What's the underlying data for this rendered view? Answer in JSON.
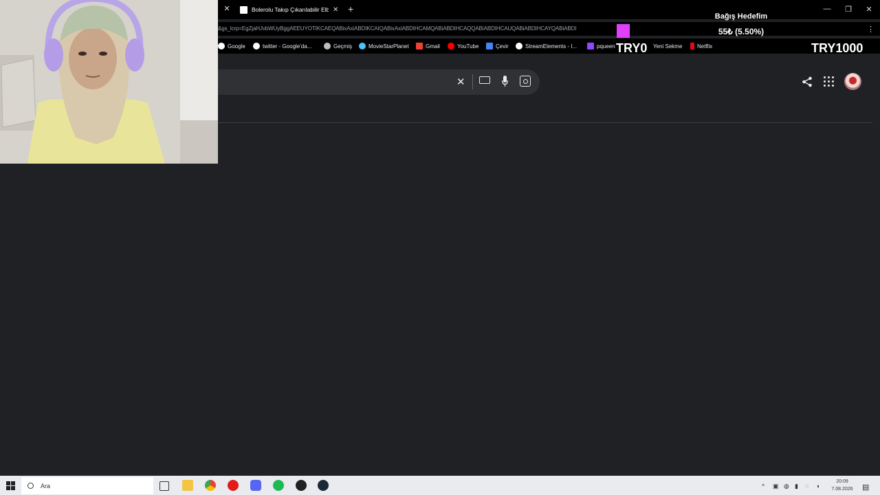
{
  "browser": {
    "active_tab_title": "Bolerolu Takıp Çıkarılabilir Elbise",
    "url": "&gs_lcrp=EgZjaHJvbWUyBggAEEUYOTIKCAEQABixAxiABDIKCAIQABixAxiABDIHCAMQABiABDIHCAQQABiABDIHCAUQABiABDIHCAYQABiABDI",
    "bookmarks": [
      {
        "label": "Google",
        "icon": "google-icon",
        "color": "#ffffff"
      },
      {
        "label": "twitter - Google'da...",
        "icon": "google-icon",
        "color": "#ffffff"
      },
      {
        "label": "Geçmiş",
        "icon": "history-icon",
        "color": "#bdbdbd"
      },
      {
        "label": "MovieStarPlanet",
        "icon": "msp-icon",
        "color": "#4fc3f7"
      },
      {
        "label": "Gmail",
        "icon": "gmail-icon",
        "color": "#ea4335"
      },
      {
        "label": "YouTube",
        "icon": "youtube-icon",
        "color": "#ff0000"
      },
      {
        "label": "Çevir",
        "icon": "translate-icon",
        "color": "#4285f4"
      },
      {
        "label": "StreamElements - I...",
        "icon": "streamelements-icon",
        "color": "#ffffff"
      },
      {
        "label": "pqueen",
        "icon": "twitch-icon",
        "color": "#9146ff"
      },
      {
        "label": "Yeni Sekme",
        "icon": "",
        "color": ""
      },
      {
        "label": "Netflix",
        "icon": "netflix-icon",
        "color": "#e50914"
      }
    ]
  },
  "overlay": {
    "donation_title": "Bağış Hedefim",
    "donation_amount": "55₺ (5.50%)",
    "current": "TRY0",
    "goal": "TRY1000"
  },
  "taskbar": {
    "search_placeholder": "Ara",
    "time": "20:09",
    "date": "7.08.2026"
  },
  "colors": {
    "page_bg": "#202124",
    "search_bg": "#303134",
    "accent_pink": "#e040fb"
  }
}
